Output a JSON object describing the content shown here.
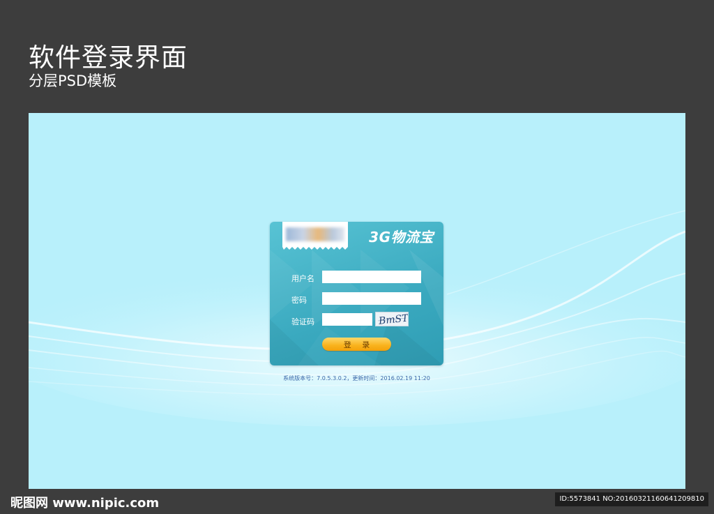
{
  "header": {
    "title": "软件登录界面",
    "subtitle": "分层PSD模板"
  },
  "login": {
    "app_name": "3G物流宝",
    "username_label": "用户名",
    "password_label": "密码",
    "captcha_label": "验证码",
    "captcha_text": "BmST",
    "login_button": "登 录",
    "version_info": "系统版本号：7.0.5.3.0.2，更新时间：2016.02.19 11:20"
  },
  "colors": {
    "frame_background": "#3d3d3d",
    "canvas_background": "#b8f0fb",
    "panel": "#3aa9bf",
    "button": "#f9b21c",
    "version_text": "#3b67a8"
  },
  "footer": {
    "logo_text": "昵图网 www.nipic.com",
    "id_text": "ID:5573841 NO:20160321160641209810"
  }
}
